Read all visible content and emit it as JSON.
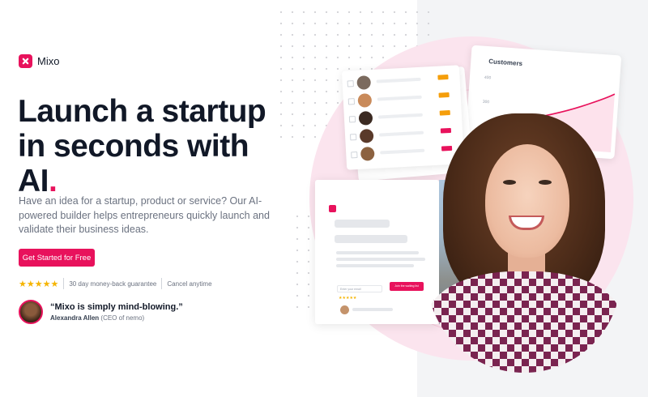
{
  "brand": {
    "name": "Mixo",
    "color": "#e8125c"
  },
  "hero": {
    "headline_main": "Launch a startup in seconds with AI",
    "headline_dot": ".",
    "description": "Have an idea for a startup, product or service? Our AI-powered builder helps entrepreneurs quickly launch and validate their business ideas.",
    "cta_label": "Get Started for Free"
  },
  "trust": {
    "stars": "★★★★★",
    "rating": 5,
    "guarantee": "30 day money-back guarantee",
    "cancel": "Cancel anytime"
  },
  "testimonial": {
    "quote": "“Mixo is simply mind-blowing.”",
    "author_name": "Alexandra Allen",
    "author_role": "(CEO of nemo)"
  },
  "illustration": {
    "chart_card": {
      "title": "Customers",
      "y_ticks": [
        "400",
        "300",
        "200"
      ]
    },
    "list_card": {
      "tag_colors": [
        "#f59e0b",
        "#f59e0b",
        "#f59e0b",
        "#e8125c",
        "#e8125c"
      ]
    },
    "page_card": {
      "input_placeholder": "Enter your email",
      "button_label": "Join the waiting list",
      "stars": "★★★★★"
    }
  }
}
